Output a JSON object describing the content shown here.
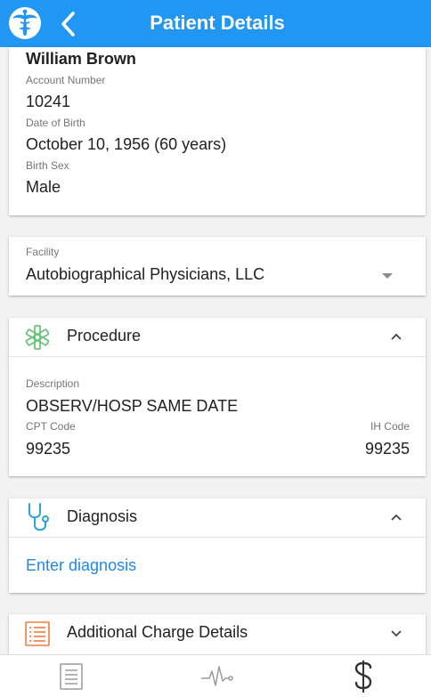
{
  "header": {
    "title": "Patient Details",
    "logo_icon": "caduceus-icon",
    "back_icon": "chevron-left-icon",
    "bg_color": "#2196f3"
  },
  "patient": {
    "name": "William Brown",
    "account_label": "Account Number",
    "account_value": "10241",
    "dob_label": "Date of Birth",
    "dob_value": "October 10, 1956 (60 years)",
    "sex_label": "Birth Sex",
    "sex_value": "Male"
  },
  "facility": {
    "label": "Facility",
    "value": "Autobiographical Physicians, LLC"
  },
  "procedure": {
    "title": "Procedure",
    "icon": "medical-asterisk-icon",
    "description_label": "Description",
    "description_value": "OBSERV/HOSP SAME DATE",
    "cpt_label": "CPT Code",
    "cpt_value": "99235",
    "ih_label": "IH Code",
    "ih_value": "99235"
  },
  "diagnosis": {
    "title": "Diagnosis",
    "icon": "stethoscope-icon",
    "link": "Enter diagnosis"
  },
  "additional": {
    "title": "Additional Charge Details",
    "icon": "list-icon"
  },
  "bottom_nav": [
    {
      "icon": "document-icon"
    },
    {
      "icon": "vitals-icon"
    },
    {
      "icon": "dollar-icon"
    }
  ]
}
